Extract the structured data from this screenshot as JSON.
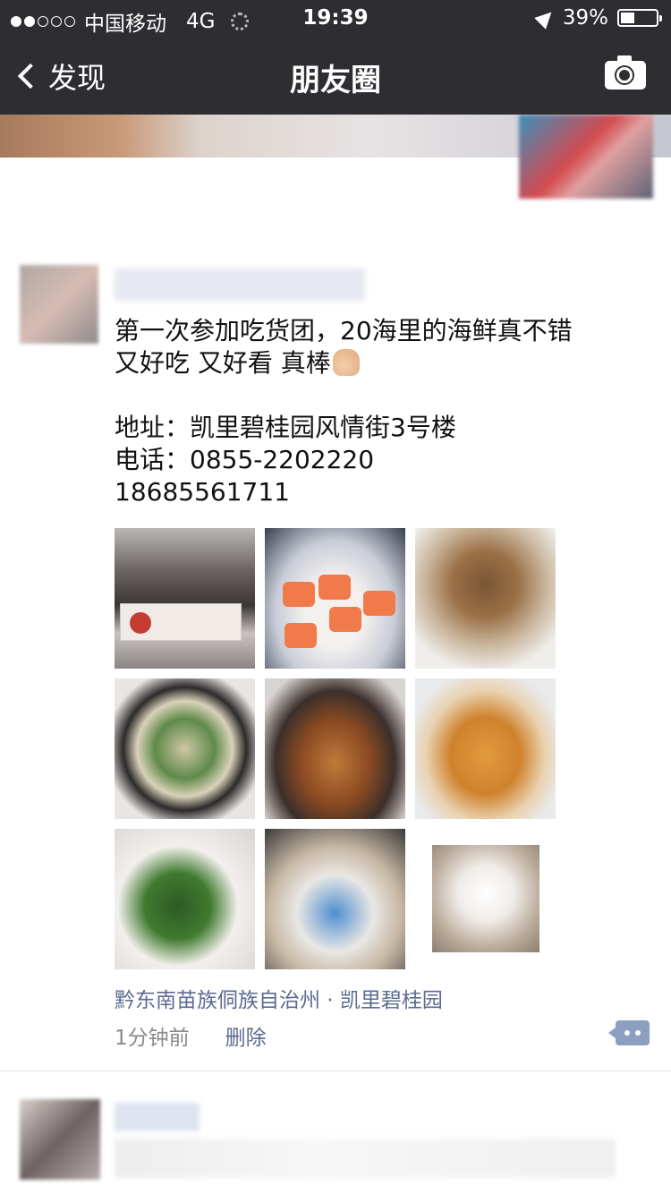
{
  "status_bar": {
    "carrier": "中国移动",
    "network": "4G",
    "time": "19:39",
    "battery": "39%",
    "battery_level": 0.39,
    "signal_strength": 2
  },
  "nav": {
    "back_label": "发现",
    "title": "朋友圈",
    "icons": {
      "back": "chevron-left-icon",
      "camera": "camera-icon"
    }
  },
  "post": {
    "text_lines": [
      "第一次参加吃货团，20海里的海鲜真不错",
      "又好吃 又好看 真棒",
      "",
      "地址：凯里碧桂园风情街3号楼",
      "电话：0855-2202220",
      "18685561711"
    ],
    "emoji": "thumbs-up-icon",
    "location": "黔东南苗族侗族自治州 · 凯里碧桂园",
    "time_ago": "1分钟前",
    "delete_label": "删除",
    "comment_icon": "comment-icon"
  },
  "colors": {
    "nav_bg": "#2e2d31",
    "link": "#5b6a91",
    "meta": "#8a8a8a",
    "comment_button": "#8c9fc0"
  }
}
